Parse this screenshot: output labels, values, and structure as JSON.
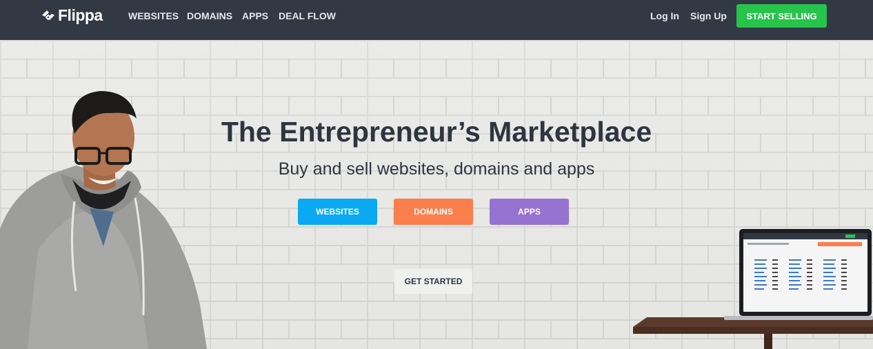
{
  "brand": {
    "name": "Flippa",
    "accent": "#27c44b",
    "nav_bg": "#323844"
  },
  "nav": {
    "links": [
      "WEBSITES",
      "DOMAINS",
      "APPS",
      "DEAL FLOW"
    ],
    "login": "Log In",
    "signup": "Sign Up",
    "cta": "START SELLING"
  },
  "hero": {
    "title": "The Entrepreneur’s Marketplace",
    "subtitle": "Buy and sell websites, domains and apps",
    "buttons": [
      {
        "label": "WEBSITES",
        "color": "#0ba9f3"
      },
      {
        "label": "DOMAINS",
        "color": "#fb7e4d"
      },
      {
        "label": "APPS",
        "color": "#9673d0"
      }
    ],
    "get_started": "GET STARTED"
  },
  "icons": [
    "flippa-logo-icon"
  ]
}
